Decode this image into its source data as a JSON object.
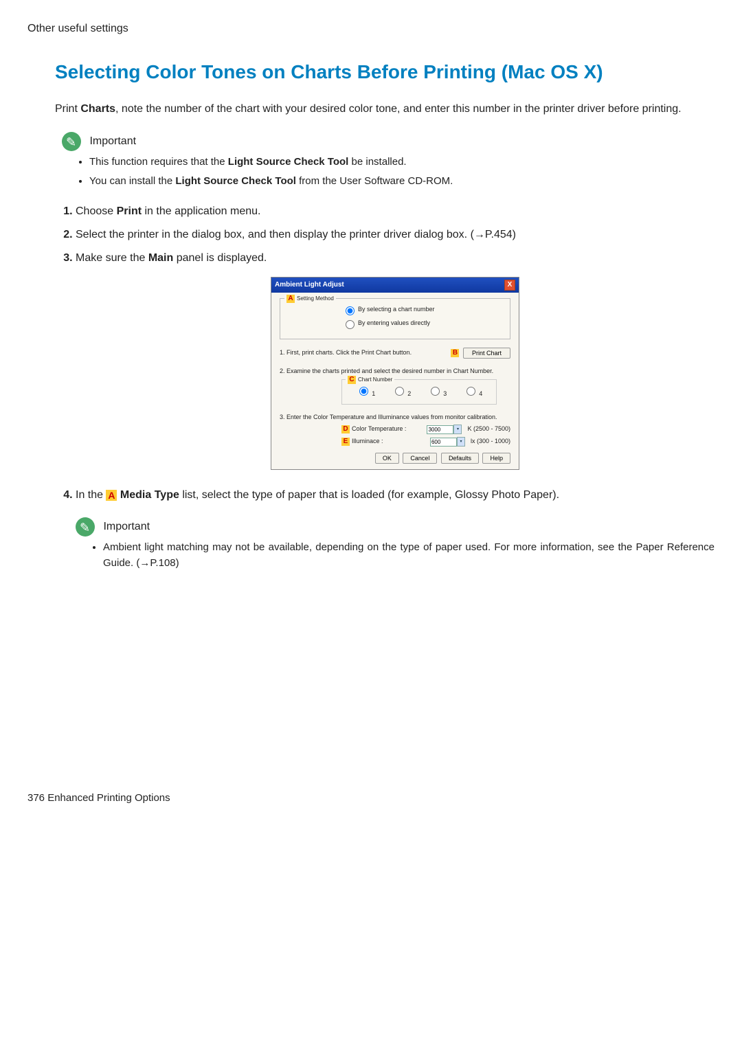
{
  "header": {
    "section": "Other useful settings"
  },
  "title": "Selecting Color Tones on Charts Before Printing (Mac OS X)",
  "intro": {
    "pre": "Print ",
    "bold1": "Charts",
    "post": ", note the number of the chart with your desired color tone, and enter this number in the printer driver before printing."
  },
  "important1": {
    "label": "Important",
    "items": {
      "i0": {
        "pre": "This function requires that the ",
        "bold": "Light Source Check Tool",
        "post": " be installed."
      },
      "i1": {
        "pre": "You can install the ",
        "bold": "Light Source Check Tool",
        "post": " from the User Software CD-ROM."
      }
    }
  },
  "steps": {
    "s1": {
      "pre": "Choose ",
      "bold": "Print",
      "post": " in the application menu."
    },
    "s2": {
      "text": "Select the printer in the dialog box, and then display the printer driver dialog box.  (→P.454)"
    },
    "s3": {
      "pre": "Make sure the ",
      "bold": "Main",
      "post": " panel is displayed."
    },
    "s4": {
      "pre": "In the ",
      "tag": "A",
      "bold": " Media Type",
      "post": " list, select the type of paper that is loaded (for example, Glossy Photo Paper)."
    }
  },
  "dialog": {
    "title": "Ambient Light Adjust",
    "close": "X",
    "tagA": "A",
    "setting_method": "Setting Method",
    "radio1": "By selecting a chart number",
    "radio2": "By entering values directly",
    "step1": "1.  First, print charts. Click the Print Chart button.",
    "tagB": "B",
    "print_chart": "Print Chart",
    "step2": "2.  Examine the charts printed and select the desired number in Chart Number.",
    "tagC": "C",
    "chart_number": "Chart Number",
    "opts": {
      "o1": "1",
      "o2": "2",
      "o3": "3",
      "o4": "4"
    },
    "step3": "3.  Enter the Color Temperature and Illuminance values from monitor calibration.",
    "tagD": "D",
    "color_temp_label": "Color Temperature :",
    "color_temp_value": "3000",
    "color_temp_range": "K (2500 - 7500)",
    "tagE": "E",
    "illum_label": "Illuminace :",
    "illum_value": "600",
    "illum_range": "lx (300 - 1000)",
    "buttons": {
      "ok": "OK",
      "cancel": "Cancel",
      "defaults": "Defaults",
      "help": "Help"
    }
  },
  "important2": {
    "label": "Important",
    "item": "Ambient light matching may not be available, depending on the type of paper used.  For more information, see the Paper Reference Guide.  (→P.108)"
  },
  "footer": {
    "page": "376",
    "chapter": " Enhanced Printing Options"
  }
}
